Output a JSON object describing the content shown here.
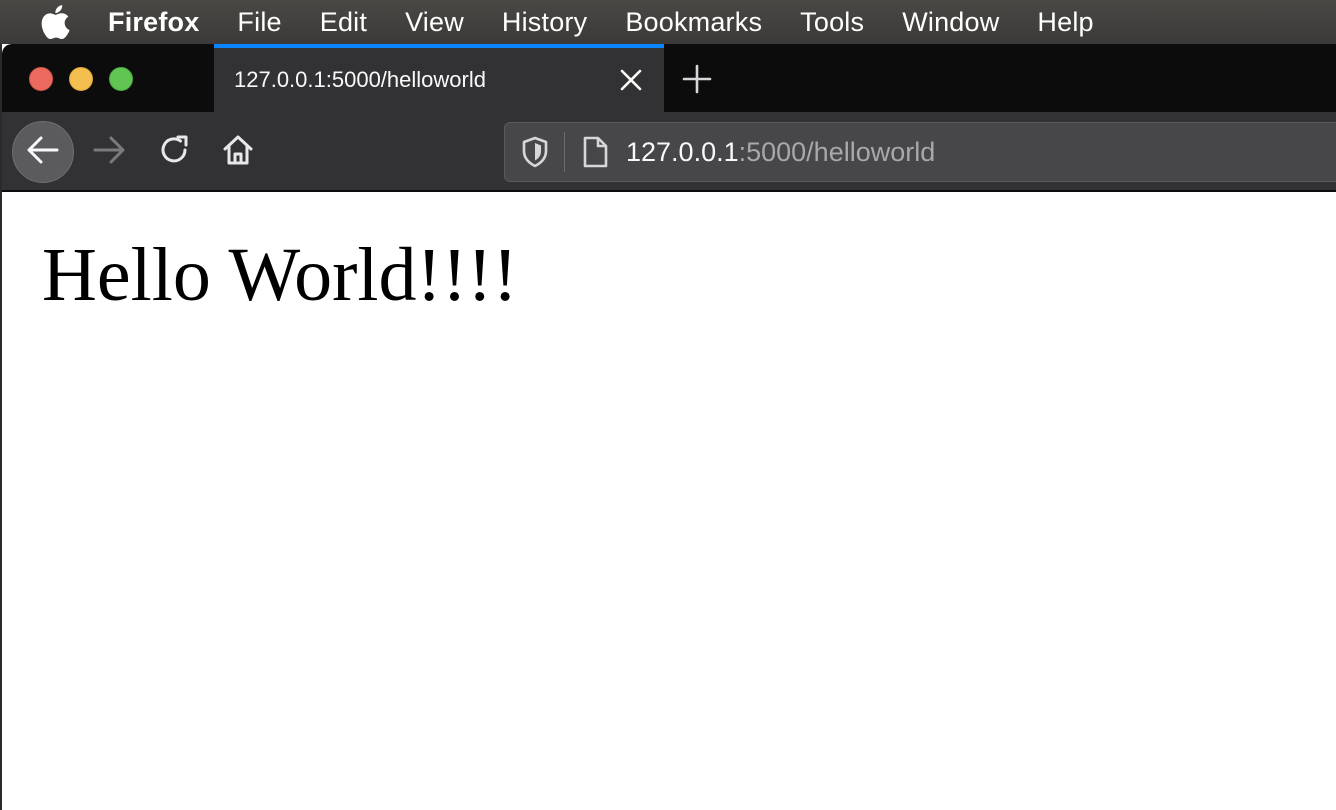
{
  "menubar": {
    "app_name": "Firefox",
    "items": [
      "File",
      "Edit",
      "View",
      "History",
      "Bookmarks",
      "Tools",
      "Window",
      "Help"
    ]
  },
  "tab": {
    "title": "127.0.0.1:5000/helloworld"
  },
  "urlbar": {
    "host": "127.0.0.1",
    "rest": ":5000/helloworld"
  },
  "page": {
    "heading": "Hello World!!!!"
  },
  "colors": {
    "accent": "#0a84ff",
    "toolbar": "#323234",
    "tabstrip": "#0c0c0d",
    "traffic_close": "#ed6a5e",
    "traffic_minimize": "#f5bf4f",
    "traffic_maximize": "#61c554"
  },
  "icons": {
    "apple": "apple-logo-icon",
    "tab_close": "close-icon",
    "new_tab": "plus-icon",
    "back": "back-arrow-icon",
    "forward": "forward-arrow-icon",
    "reload": "reload-icon",
    "home": "home-icon",
    "tracking_protection": "shield-icon",
    "page_info": "page-icon"
  }
}
